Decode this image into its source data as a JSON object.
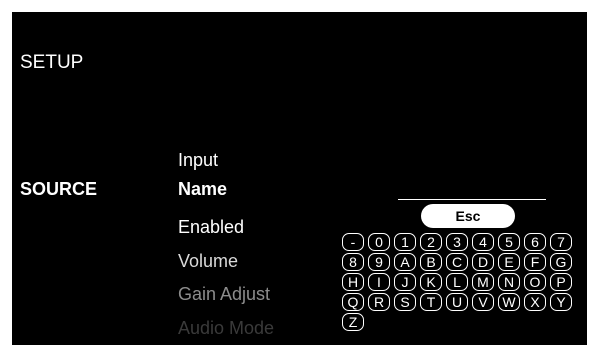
{
  "header": {
    "title": "SETUP"
  },
  "section": {
    "label": "SOURCE"
  },
  "menu": {
    "items": [
      {
        "label": "Input",
        "color": "#ffffff"
      },
      {
        "label": "Name",
        "color": "#ffffff",
        "selected": true
      },
      {
        "label": "Enabled",
        "color": "#ffffff"
      },
      {
        "label": "Volume",
        "color": "#d9d9d9"
      },
      {
        "label": "Gain Adjust",
        "color": "#8c8c8c"
      },
      {
        "label": "Audio Mode",
        "color": "#3a3a3a"
      }
    ]
  },
  "name_entry": {
    "value": ""
  },
  "keyboard": {
    "esc_label": "Esc",
    "keys": [
      "-",
      "0",
      "1",
      "2",
      "3",
      "4",
      "5",
      "6",
      "7",
      "8",
      "9",
      "A",
      "B",
      "C",
      "D",
      "E",
      "F",
      "G",
      "H",
      "I",
      "J",
      "K",
      "L",
      "M",
      "N",
      "O",
      "P",
      "Q",
      "R",
      "S",
      "T",
      "U",
      "V",
      "W",
      "X",
      "Y",
      "Z"
    ]
  }
}
